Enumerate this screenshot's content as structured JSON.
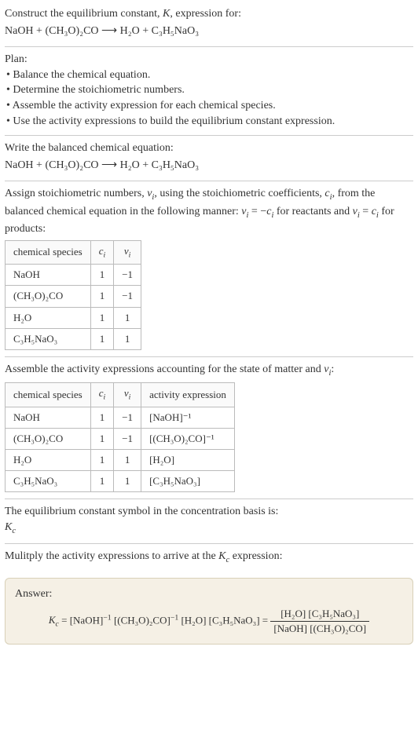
{
  "intro": {
    "line1": "Construct the equilibrium constant, K, expression for:",
    "equation": "NaOH + (CH₃O)₂CO  ⟶  H₂O + C₃H₅NaO₃"
  },
  "plan": {
    "heading": "Plan:",
    "items": [
      "• Balance the chemical equation.",
      "• Determine the stoichiometric numbers.",
      "• Assemble the activity expression for each chemical species.",
      "• Use the activity expressions to build the equilibrium constant expression."
    ]
  },
  "balanced": {
    "heading": "Write the balanced chemical equation:",
    "equation": "NaOH + (CH₃O)₂CO  ⟶  H₂O + C₃H₅NaO₃"
  },
  "stoich": {
    "text": "Assign stoichiometric numbers, νᵢ, using the stoichiometric coefficients, cᵢ, from the balanced chemical equation in the following manner: νᵢ = −cᵢ for reactants and νᵢ = cᵢ for products:",
    "headers": [
      "chemical species",
      "cᵢ",
      "νᵢ"
    ],
    "rows": [
      {
        "species": "NaOH",
        "c": "1",
        "v": "−1"
      },
      {
        "species": "(CH₃O)₂CO",
        "c": "1",
        "v": "−1"
      },
      {
        "species": "H₂O",
        "c": "1",
        "v": "1"
      },
      {
        "species": "C₃H₅NaO₃",
        "c": "1",
        "v": "1"
      }
    ]
  },
  "activity": {
    "heading": "Assemble the activity expressions accounting for the state of matter and νᵢ:",
    "headers": [
      "chemical species",
      "cᵢ",
      "νᵢ",
      "activity expression"
    ],
    "rows": [
      {
        "species": "NaOH",
        "c": "1",
        "v": "−1",
        "expr": "[NaOH]⁻¹"
      },
      {
        "species": "(CH₃O)₂CO",
        "c": "1",
        "v": "−1",
        "expr": "[(CH₃O)₂CO]⁻¹"
      },
      {
        "species": "H₂O",
        "c": "1",
        "v": "1",
        "expr": "[H₂O]"
      },
      {
        "species": "C₃H₅NaO₃",
        "c": "1",
        "v": "1",
        "expr": "[C₃H₅NaO₃]"
      }
    ]
  },
  "symbol": {
    "line1": "The equilibrium constant symbol in the concentration basis is:",
    "line2": "K𝒸"
  },
  "multiply": {
    "text": "Mulitply the activity expressions to arrive at the K𝒸 expression:"
  },
  "answer": {
    "label": "Answer:",
    "lhs": "K𝒸 = [NaOH]⁻¹ [(CH₃O)₂CO]⁻¹ [H₂O] [C₃H₅NaO₃] =",
    "num": "[H₂O] [C₃H₅NaO₃]",
    "den": "[NaOH] [(CH₃O)₂CO]"
  }
}
